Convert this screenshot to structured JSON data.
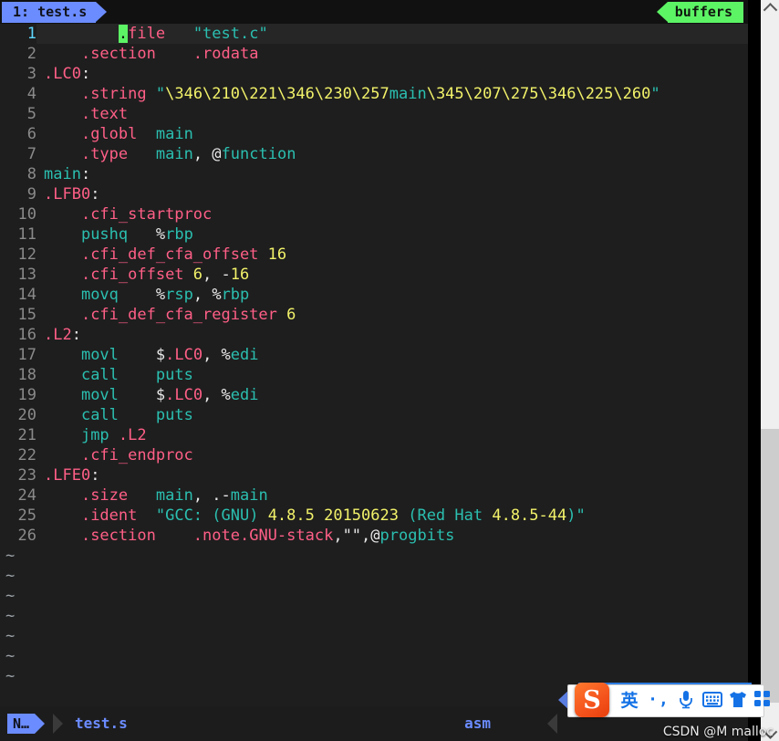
{
  "window": {
    "app": "vim",
    "bg_color": "#1e1e1e"
  },
  "tabline": {
    "tab_label": "1: test.s",
    "tab_bg": "#6b8cff",
    "buffers_label": "buffers",
    "buffers_bg": "#5cf465"
  },
  "editor": {
    "filetype": "asm",
    "cursor_line": 1,
    "cursor_char": ".",
    "lines": [
      {
        "n": "1",
        "segs": [
          {
            "t": "        ",
            "c": "fg"
          },
          {
            "t": ".",
            "c": "cursor"
          },
          {
            "t": "file",
            "c": "dir"
          },
          {
            "t": "   ",
            "c": "fg"
          },
          {
            "t": "\"test.c\"",
            "c": "str"
          }
        ]
      },
      {
        "n": "2",
        "segs": [
          {
            "t": "    ",
            "c": "fg"
          },
          {
            "t": ".section",
            "c": "dir"
          },
          {
            "t": "    ",
            "c": "fg"
          },
          {
            "t": ".rodata",
            "c": "dir"
          }
        ]
      },
      {
        "n": "3",
        "segs": [
          {
            "t": ".LC0",
            "c": "dir"
          },
          {
            "t": ":",
            "c": "fg"
          }
        ]
      },
      {
        "n": "4",
        "segs": [
          {
            "t": "    ",
            "c": "fg"
          },
          {
            "t": ".string",
            "c": "dir"
          },
          {
            "t": " ",
            "c": "fg"
          },
          {
            "t": "\"",
            "c": "str"
          },
          {
            "t": "\\346\\210\\221\\346\\230\\257",
            "c": "num"
          },
          {
            "t": "main",
            "c": "ins"
          },
          {
            "t": "\\345\\207\\275\\346\\225\\260",
            "c": "num"
          },
          {
            "t": "\"",
            "c": "str"
          }
        ]
      },
      {
        "n": "5",
        "segs": [
          {
            "t": "    ",
            "c": "fg"
          },
          {
            "t": ".text",
            "c": "dir"
          }
        ]
      },
      {
        "n": "6",
        "segs": [
          {
            "t": "    ",
            "c": "fg"
          },
          {
            "t": ".globl",
            "c": "dir"
          },
          {
            "t": "  ",
            "c": "fg"
          },
          {
            "t": "main",
            "c": "ins"
          }
        ]
      },
      {
        "n": "7",
        "segs": [
          {
            "t": "    ",
            "c": "fg"
          },
          {
            "t": ".type",
            "c": "dir"
          },
          {
            "t": "   ",
            "c": "fg"
          },
          {
            "t": "main",
            "c": "ins"
          },
          {
            "t": ", ",
            "c": "fg"
          },
          {
            "t": "@",
            "c": "fg"
          },
          {
            "t": "function",
            "c": "ins"
          }
        ]
      },
      {
        "n": "8",
        "segs": [
          {
            "t": "main",
            "c": "ins"
          },
          {
            "t": ":",
            "c": "fg"
          }
        ]
      },
      {
        "n": "9",
        "segs": [
          {
            "t": ".LFB0",
            "c": "dir"
          },
          {
            "t": ":",
            "c": "fg"
          }
        ]
      },
      {
        "n": "10",
        "segs": [
          {
            "t": "    ",
            "c": "fg"
          },
          {
            "t": ".cfi_startproc",
            "c": "dir"
          }
        ]
      },
      {
        "n": "11",
        "segs": [
          {
            "t": "    ",
            "c": "fg"
          },
          {
            "t": "pushq",
            "c": "ins"
          },
          {
            "t": "   ",
            "c": "fg"
          },
          {
            "t": "%",
            "c": "fg"
          },
          {
            "t": "rbp",
            "c": "ins"
          }
        ]
      },
      {
        "n": "12",
        "segs": [
          {
            "t": "    ",
            "c": "fg"
          },
          {
            "t": ".cfi_def_cfa_offset",
            "c": "dir"
          },
          {
            "t": " ",
            "c": "fg"
          },
          {
            "t": "16",
            "c": "num"
          }
        ]
      },
      {
        "n": "13",
        "segs": [
          {
            "t": "    ",
            "c": "fg"
          },
          {
            "t": ".cfi_offset",
            "c": "dir"
          },
          {
            "t": " ",
            "c": "fg"
          },
          {
            "t": "6",
            "c": "num"
          },
          {
            "t": ", -",
            "c": "fg"
          },
          {
            "t": "16",
            "c": "num"
          }
        ]
      },
      {
        "n": "14",
        "segs": [
          {
            "t": "    ",
            "c": "fg"
          },
          {
            "t": "movq",
            "c": "ins"
          },
          {
            "t": "    ",
            "c": "fg"
          },
          {
            "t": "%",
            "c": "fg"
          },
          {
            "t": "rsp",
            "c": "ins"
          },
          {
            "t": ", ",
            "c": "fg"
          },
          {
            "t": "%",
            "c": "fg"
          },
          {
            "t": "rbp",
            "c": "ins"
          }
        ]
      },
      {
        "n": "15",
        "segs": [
          {
            "t": "    ",
            "c": "fg"
          },
          {
            "t": ".cfi_def_cfa_register",
            "c": "dir"
          },
          {
            "t": " ",
            "c": "fg"
          },
          {
            "t": "6",
            "c": "num"
          }
        ]
      },
      {
        "n": "16",
        "segs": [
          {
            "t": ".L2",
            "c": "dir"
          },
          {
            "t": ":",
            "c": "fg"
          }
        ]
      },
      {
        "n": "17",
        "segs": [
          {
            "t": "    ",
            "c": "fg"
          },
          {
            "t": "movl",
            "c": "ins"
          },
          {
            "t": "    ",
            "c": "fg"
          },
          {
            "t": "$",
            "c": "fg"
          },
          {
            "t": ".LC0",
            "c": "dir"
          },
          {
            "t": ", ",
            "c": "fg"
          },
          {
            "t": "%",
            "c": "fg"
          },
          {
            "t": "edi",
            "c": "ins"
          }
        ]
      },
      {
        "n": "18",
        "segs": [
          {
            "t": "    ",
            "c": "fg"
          },
          {
            "t": "call",
            "c": "ins"
          },
          {
            "t": "    ",
            "c": "fg"
          },
          {
            "t": "puts",
            "c": "ins"
          }
        ]
      },
      {
        "n": "19",
        "segs": [
          {
            "t": "    ",
            "c": "fg"
          },
          {
            "t": "movl",
            "c": "ins"
          },
          {
            "t": "    ",
            "c": "fg"
          },
          {
            "t": "$",
            "c": "fg"
          },
          {
            "t": ".LC0",
            "c": "dir"
          },
          {
            "t": ", ",
            "c": "fg"
          },
          {
            "t": "%",
            "c": "fg"
          },
          {
            "t": "edi",
            "c": "ins"
          }
        ]
      },
      {
        "n": "20",
        "segs": [
          {
            "t": "    ",
            "c": "fg"
          },
          {
            "t": "call",
            "c": "ins"
          },
          {
            "t": "    ",
            "c": "fg"
          },
          {
            "t": "puts",
            "c": "ins"
          }
        ]
      },
      {
        "n": "21",
        "segs": [
          {
            "t": "    ",
            "c": "fg"
          },
          {
            "t": "jmp",
            "c": "ins"
          },
          {
            "t": " ",
            "c": "fg"
          },
          {
            "t": ".L2",
            "c": "dir"
          }
        ]
      },
      {
        "n": "22",
        "segs": [
          {
            "t": "    ",
            "c": "fg"
          },
          {
            "t": ".cfi_endproc",
            "c": "dir"
          }
        ]
      },
      {
        "n": "23",
        "segs": [
          {
            "t": ".LFE0",
            "c": "dir"
          },
          {
            "t": ":",
            "c": "fg"
          }
        ]
      },
      {
        "n": "24",
        "segs": [
          {
            "t": "    ",
            "c": "fg"
          },
          {
            "t": ".size",
            "c": "dir"
          },
          {
            "t": "   ",
            "c": "fg"
          },
          {
            "t": "main",
            "c": "ins"
          },
          {
            "t": ", .-",
            "c": "fg"
          },
          {
            "t": "main",
            "c": "ins"
          }
        ]
      },
      {
        "n": "25",
        "segs": [
          {
            "t": "    ",
            "c": "fg"
          },
          {
            "t": ".ident",
            "c": "dir"
          },
          {
            "t": "  ",
            "c": "fg"
          },
          {
            "t": "\"GCC: (GNU) ",
            "c": "str"
          },
          {
            "t": "4.8.5 20150623",
            "c": "num"
          },
          {
            "t": " (Red Hat ",
            "c": "str"
          },
          {
            "t": "4.8.5-44",
            "c": "num"
          },
          {
            "t": ")\"",
            "c": "str"
          }
        ]
      },
      {
        "n": "26",
        "segs": [
          {
            "t": "    ",
            "c": "fg"
          },
          {
            "t": ".section",
            "c": "dir"
          },
          {
            "t": "    ",
            "c": "fg"
          },
          {
            "t": ".note.GNU-stack",
            "c": "dir"
          },
          {
            "t": ",\"\",",
            "c": "fg"
          },
          {
            "t": "@",
            "c": "fg"
          },
          {
            "t": "progbits",
            "c": "ins"
          }
        ]
      }
    ],
    "empty_marker": "~",
    "empty_count": 7
  },
  "statusline": {
    "mode": "N…",
    "filename": "test.s",
    "filetype": "asm"
  },
  "scrollbar": {
    "up_icon": "chevron-up-icon",
    "down_icon": "chevron-down-icon"
  },
  "ime": {
    "logo": "S",
    "lang_label": "英",
    "punctuation_label": "·,",
    "mic_icon": "microphone-icon",
    "keyboard_icon": "keyboard-icon",
    "skin_icon": "tshirt-icon",
    "menu_icon": "grid-menu-icon"
  },
  "watermark": {
    "text": "CSDN @M malloc"
  }
}
